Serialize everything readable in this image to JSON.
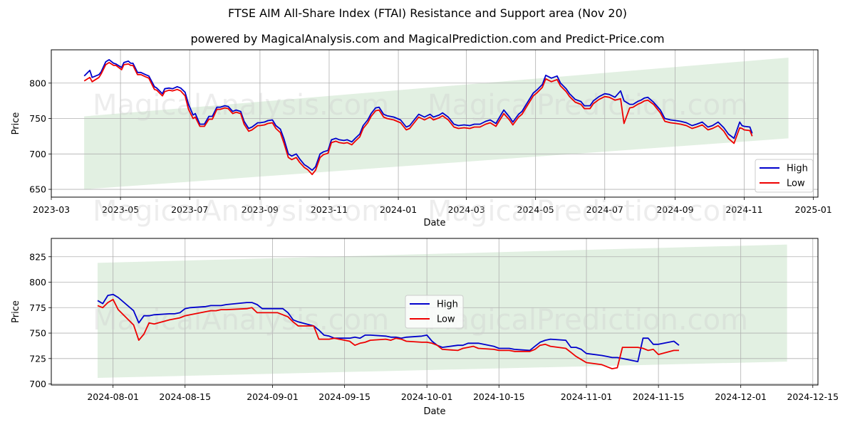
{
  "header": {
    "title": "FTSE AIM All-Share Index (FTAI) Resistance and Support area (Nov 20)",
    "subtitle": "powered by MagicalAnalysis.com and MagicalPrediction.com and Predict-Price.com"
  },
  "watermarks": [
    "MagicalAnalysis.com",
    "MagicalPrediction.com"
  ],
  "colors": {
    "high": "#0000cc",
    "low": "#ee0000",
    "band": "#d6e9d6",
    "grid": "#b0b0b0"
  },
  "chart_data": [
    {
      "type": "line",
      "title": "",
      "xlabel": "Date",
      "ylabel": "Price",
      "ylim": [
        639,
        847
      ],
      "xlim": [
        "2023-03-01",
        "2025-01-05"
      ],
      "grid": true,
      "legend": {
        "placement": "bottom-right",
        "entries": [
          "High",
          "Low"
        ]
      },
      "xticks": [
        "2023-03",
        "2023-05",
        "2023-07",
        "2023-09",
        "2023-11",
        "2024-01",
        "2024-03",
        "2024-05",
        "2024-07",
        "2024-09",
        "2024-11",
        "2025-01"
      ],
      "xtick_dates": [
        "2023-03-01",
        "2023-05-01",
        "2023-07-01",
        "2023-09-01",
        "2023-11-01",
        "2024-01-01",
        "2024-03-01",
        "2024-05-01",
        "2024-07-01",
        "2024-09-01",
        "2024-11-01",
        "2025-01-01"
      ],
      "yticks": [
        650,
        700,
        750,
        800
      ],
      "band": {
        "x": [
          "2023-03-30",
          "2024-12-10"
        ],
        "upper": [
          753,
          836
        ],
        "lower": [
          650,
          722
        ]
      },
      "x": [
        "2023-03-30",
        "2023-04-04",
        "2023-04-06",
        "2023-04-12",
        "2023-04-14",
        "2023-04-18",
        "2023-04-21",
        "2023-04-25",
        "2023-04-27",
        "2023-05-02",
        "2023-05-04",
        "2023-05-08",
        "2023-05-10",
        "2023-05-12",
        "2023-05-16",
        "2023-05-19",
        "2023-05-23",
        "2023-05-26",
        "2023-05-31",
        "2023-06-02",
        "2023-06-07",
        "2023-06-09",
        "2023-06-13",
        "2023-06-16",
        "2023-06-20",
        "2023-06-23",
        "2023-06-27",
        "2023-06-30",
        "2023-07-04",
        "2023-07-06",
        "2023-07-10",
        "2023-07-14",
        "2023-07-18",
        "2023-07-21",
        "2023-07-25",
        "2023-07-28",
        "2023-08-01",
        "2023-08-04",
        "2023-08-08",
        "2023-08-11",
        "2023-08-15",
        "2023-08-18",
        "2023-08-22",
        "2023-08-25",
        "2023-08-30",
        "2023-09-01",
        "2023-09-05",
        "2023-09-08",
        "2023-09-12",
        "2023-09-15",
        "2023-09-19",
        "2023-09-22",
        "2023-09-26",
        "2023-09-29",
        "2023-10-03",
        "2023-10-06",
        "2023-10-10",
        "2023-10-13",
        "2023-10-17",
        "2023-10-20",
        "2023-10-24",
        "2023-10-27",
        "2023-10-31",
        "2023-11-03",
        "2023-11-07",
        "2023-11-10",
        "2023-11-14",
        "2023-11-17",
        "2023-11-21",
        "2023-11-24",
        "2023-11-28",
        "2023-12-01",
        "2023-12-05",
        "2023-12-08",
        "2023-12-12",
        "2023-12-15",
        "2023-12-19",
        "2023-12-22",
        "2023-12-28",
        "2024-01-03",
        "2024-01-08",
        "2024-01-11",
        "2024-01-16",
        "2024-01-19",
        "2024-01-24",
        "2024-01-29",
        "2024-02-01",
        "2024-02-06",
        "2024-02-09",
        "2024-02-14",
        "2024-02-19",
        "2024-02-23",
        "2024-02-28",
        "2024-03-04",
        "2024-03-08",
        "2024-03-13",
        "2024-03-18",
        "2024-03-22",
        "2024-03-27",
        "2024-04-03",
        "2024-04-08",
        "2024-04-11",
        "2024-04-16",
        "2024-04-19",
        "2024-04-24",
        "2024-04-29",
        "2024-05-02",
        "2024-05-07",
        "2024-05-10",
        "2024-05-15",
        "2024-05-20",
        "2024-05-23",
        "2024-05-28",
        "2024-05-31",
        "2024-06-05",
        "2024-06-10",
        "2024-06-13",
        "2024-06-18",
        "2024-06-21",
        "2024-06-26",
        "2024-07-01",
        "2024-07-05",
        "2024-07-10",
        "2024-07-15",
        "2024-07-18",
        "2024-07-23",
        "2024-07-26",
        "2024-07-30",
        "2024-08-02",
        "2024-08-05",
        "2024-08-08",
        "2024-08-13",
        "2024-08-19",
        "2024-08-23",
        "2024-08-28",
        "2024-09-02",
        "2024-09-06",
        "2024-09-11",
        "2024-09-16",
        "2024-09-20",
        "2024-09-25",
        "2024-09-30",
        "2024-10-04",
        "2024-10-09",
        "2024-10-14",
        "2024-10-18",
        "2024-10-23",
        "2024-10-28",
        "2024-10-30",
        "2024-11-01",
        "2024-11-06",
        "2024-11-08",
        "2024-11-12",
        "2024-11-19"
      ],
      "series": [
        {
          "name": "High",
          "values": [
            810,
            818,
            808,
            812,
            816,
            830,
            833,
            828,
            827,
            822,
            829,
            831,
            828,
            828,
            815,
            815,
            812,
            810,
            795,
            793,
            785,
            792,
            793,
            792,
            795,
            793,
            787,
            770,
            755,
            757,
            742,
            742,
            753,
            753,
            766,
            766,
            768,
            767,
            760,
            762,
            760,
            746,
            736,
            738,
            744,
            744,
            745,
            747,
            748,
            740,
            735,
            722,
            700,
            697,
            700,
            693,
            685,
            682,
            677,
            682,
            700,
            703,
            705,
            720,
            722,
            720,
            719,
            720,
            717,
            722,
            728,
            740,
            748,
            757,
            765,
            766,
            756,
            754,
            752,
            748,
            738,
            740,
            750,
            756,
            752,
            756,
            752,
            755,
            758,
            752,
            742,
            740,
            741,
            740,
            742,
            742,
            746,
            748,
            743,
            762,
            752,
            745,
            756,
            760,
            773,
            786,
            790,
            798,
            811,
            807,
            810,
            800,
            792,
            785,
            777,
            774,
            768,
            768,
            775,
            781,
            785,
            784,
            780,
            789,
            775,
            770,
            770,
            774,
            776,
            779,
            780,
            773,
            762,
            750,
            748,
            747,
            746,
            744,
            740,
            742,
            745,
            738,
            740,
            745,
            737,
            728,
            722,
            745,
            740,
            739,
            738,
            729
          ]
        },
        {
          "name": "Low",
          "values": [
            803,
            808,
            802,
            808,
            813,
            826,
            829,
            825,
            825,
            819,
            826,
            827,
            825,
            825,
            812,
            812,
            809,
            807,
            791,
            790,
            782,
            788,
            790,
            789,
            791,
            789,
            782,
            763,
            750,
            752,
            739,
            739,
            749,
            749,
            763,
            763,
            765,
            764,
            757,
            759,
            757,
            742,
            732,
            734,
            740,
            740,
            741,
            743,
            744,
            736,
            730,
            716,
            695,
            692,
            695,
            688,
            681,
            678,
            671,
            677,
            695,
            699,
            701,
            716,
            718,
            716,
            715,
            716,
            713,
            718,
            724,
            736,
            744,
            753,
            761,
            762,
            752,
            750,
            748,
            744,
            734,
            736,
            746,
            752,
            748,
            752,
            748,
            751,
            754,
            748,
            738,
            736,
            737,
            736,
            738,
            738,
            742,
            744,
            739,
            757,
            748,
            741,
            752,
            756,
            769,
            782,
            786,
            794,
            806,
            802,
            805,
            796,
            788,
            781,
            773,
            770,
            764,
            764,
            771,
            777,
            781,
            780,
            776,
            778,
            743,
            765,
            766,
            770,
            772,
            775,
            776,
            770,
            758,
            746,
            744,
            743,
            742,
            740,
            736,
            738,
            741,
            734,
            736,
            740,
            732,
            722,
            715,
            737,
            736,
            734,
            733,
            725
          ]
        }
      ]
    },
    {
      "type": "line",
      "title": "",
      "xlabel": "Date",
      "ylabel": "Price",
      "ylim": [
        699,
        843
      ],
      "xlim": [
        "2024-07-20",
        "2024-12-16"
      ],
      "grid": true,
      "legend": {
        "placement": "center",
        "entries": [
          "High",
          "Low"
        ]
      },
      "xticks": [
        "2024-08-01",
        "2024-08-15",
        "2024-09-01",
        "2024-09-15",
        "2024-10-01",
        "2024-10-15",
        "2024-11-01",
        "2024-11-15",
        "2024-12-01",
        "2024-12-15"
      ],
      "yticks": [
        700,
        725,
        750,
        775,
        800,
        825
      ],
      "band": {
        "x": [
          "2024-07-29",
          "2024-12-10"
        ],
        "upper": [
          819,
          837
        ],
        "lower": [
          706,
          722
        ]
      },
      "x": [
        "2024-07-29",
        "2024-07-30",
        "2024-07-31",
        "2024-08-01",
        "2024-08-02",
        "2024-08-05",
        "2024-08-06",
        "2024-08-07",
        "2024-08-08",
        "2024-08-09",
        "2024-08-12",
        "2024-08-13",
        "2024-08-14",
        "2024-08-15",
        "2024-08-16",
        "2024-08-19",
        "2024-08-20",
        "2024-08-21",
        "2024-08-22",
        "2024-08-23",
        "2024-08-27",
        "2024-08-28",
        "2024-08-29",
        "2024-08-30",
        "2024-09-02",
        "2024-09-03",
        "2024-09-04",
        "2024-09-05",
        "2024-09-06",
        "2024-09-09",
        "2024-09-10",
        "2024-09-11",
        "2024-09-12",
        "2024-09-13",
        "2024-09-16",
        "2024-09-17",
        "2024-09-18",
        "2024-09-19",
        "2024-09-20",
        "2024-09-23",
        "2024-09-24",
        "2024-09-25",
        "2024-09-26",
        "2024-09-27",
        "2024-09-30",
        "2024-10-01",
        "2024-10-02",
        "2024-10-03",
        "2024-10-04",
        "2024-10-07",
        "2024-10-08",
        "2024-10-09",
        "2024-10-10",
        "2024-10-11",
        "2024-10-14",
        "2024-10-15",
        "2024-10-16",
        "2024-10-17",
        "2024-10-18",
        "2024-10-21",
        "2024-10-22",
        "2024-10-23",
        "2024-10-24",
        "2024-10-25",
        "2024-10-28",
        "2024-10-29",
        "2024-10-30",
        "2024-10-31",
        "2024-11-01",
        "2024-11-04",
        "2024-11-05",
        "2024-11-06",
        "2024-11-07",
        "2024-11-08",
        "2024-11-11",
        "2024-11-12",
        "2024-11-13",
        "2024-11-14",
        "2024-11-15",
        "2024-11-18",
        "2024-11-19"
      ],
      "series": [
        {
          "name": "High",
          "values": [
            782,
            779,
            787,
            788,
            785,
            772,
            760,
            767,
            767,
            768,
            769,
            769,
            770,
            774,
            775,
            776,
            777,
            777,
            777,
            778,
            780,
            780,
            778,
            774,
            774,
            774,
            770,
            763,
            761,
            757,
            753,
            748,
            747,
            745,
            745,
            746,
            745,
            748,
            748,
            747,
            746,
            746,
            745,
            746,
            747,
            748,
            742,
            738,
            736,
            738,
            738,
            740,
            740,
            740,
            737,
            735,
            735,
            735,
            734,
            733,
            737,
            741,
            743,
            744,
            743,
            736,
            736,
            734,
            730,
            728,
            727,
            726,
            726,
            725,
            722,
            745,
            745,
            739,
            739,
            742,
            738
          ]
        },
        {
          "name": "Low",
          "values": [
            777,
            775,
            780,
            783,
            773,
            758,
            743,
            749,
            760,
            759,
            763,
            764,
            765,
            767,
            768,
            771,
            772,
            772,
            773,
            773,
            774,
            775,
            770,
            770,
            770,
            768,
            766,
            761,
            757,
            757,
            744,
            744,
            744,
            745,
            742,
            738,
            740,
            741,
            743,
            744,
            743,
            745,
            744,
            742,
            741,
            741,
            740,
            738,
            734,
            733,
            735,
            736,
            737,
            735,
            734,
            733,
            733,
            733,
            732,
            732,
            734,
            738,
            739,
            737,
            735,
            731,
            727,
            724,
            721,
            719,
            717,
            715,
            716,
            736,
            736,
            735,
            733,
            734,
            729,
            733,
            733
          ]
        }
      ]
    }
  ]
}
